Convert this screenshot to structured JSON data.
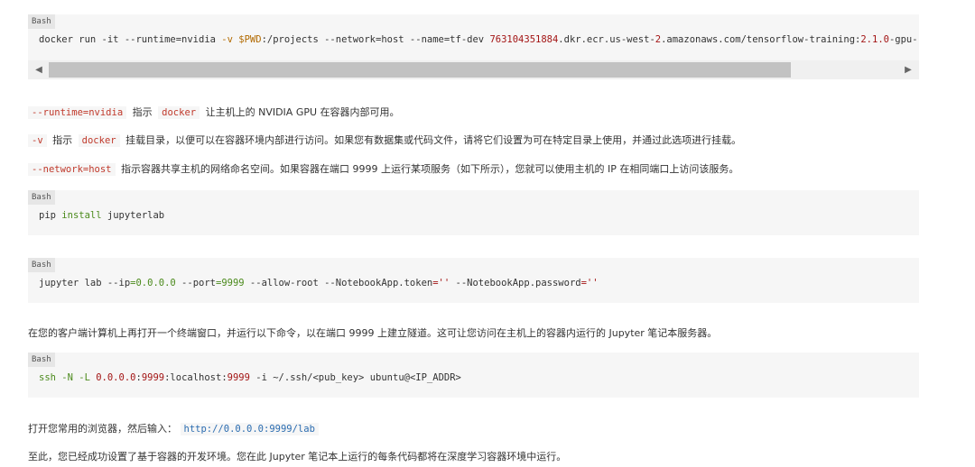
{
  "block1": {
    "lang": "Bash",
    "code_prefix": "docker run -it --runtime=nvidia ",
    "code_flag": "-v",
    "code_var": " $PWD",
    "code_mid": ":/projects --network=host --name=tf-dev ",
    "code_num": "763104351884",
    "code_mid2": ".dkr.ecr.us-west-",
    "code_num2": "2",
    "code_mid3": ".amazonaws.com/tensorflow-training:",
    "code_ver": "2.1.0",
    "code_end": "-gpu-",
    "scroll_left": "◀",
    "scroll_right": "▶"
  },
  "para1": {
    "code1": "--runtime=nvidia",
    "text1": "指示",
    "code2": "docker",
    "text2": "让主机上的 NVIDIA GPU 在容器内部可用。"
  },
  "para2": {
    "code1": "-v",
    "text1": "指示",
    "code2": "docker",
    "text2": "挂载目录，以便可以在容器环境内部进行访问。如果您有数据集或代码文件，请将它们设置为可在特定目录上使用，并通过此选项进行挂载。"
  },
  "para3": {
    "code1": "--network=host",
    "text1": "指示容器共享主机的网络命名空间。如果容器在端口 9999 上运行某项服务（如下所示），您就可以使用主机的 IP 在相同端口上访问该服务。"
  },
  "block2": {
    "lang": "Bash",
    "c1": "pip ",
    "c2": "install",
    "c3": " jupyterlab"
  },
  "block3": {
    "lang": "Bash",
    "c1": "jupyter lab --ip",
    "c2": "=0.0.0.0",
    "c3": " --port",
    "c4": "=9999",
    "c5": " --allow-root --NotebookApp.token",
    "c6": "=''",
    "c7": " --NotebookApp.password",
    "c8": "=''"
  },
  "para4": {
    "text": "在您的客户端计算机上再打开一个终端窗口，并运行以下命令，以在端口 9999 上建立隧道。这可让您访问在主机上的容器内运行的 Jupyter 笔记本服务器。"
  },
  "block4": {
    "lang": "Bash",
    "c1": "ssh -N -L ",
    "c2": "0.0.0.0",
    "c3": ":",
    "c4": "9999",
    "c5": ":localhost:",
    "c6": "9999",
    "c7": " -i ~/.ssh/<pub_key> ubuntu@<IP_ADDR>"
  },
  "para5": {
    "text": "打开您常用的浏览器，然后输入：",
    "link": "http://0.0.0.0:9999/lab"
  },
  "para6": {
    "text": "至此，您已经成功设置了基于容器的开发环境。您在此 Jupyter 笔记本上运行的每条代码都将在深度学习容器环境中运行。"
  }
}
